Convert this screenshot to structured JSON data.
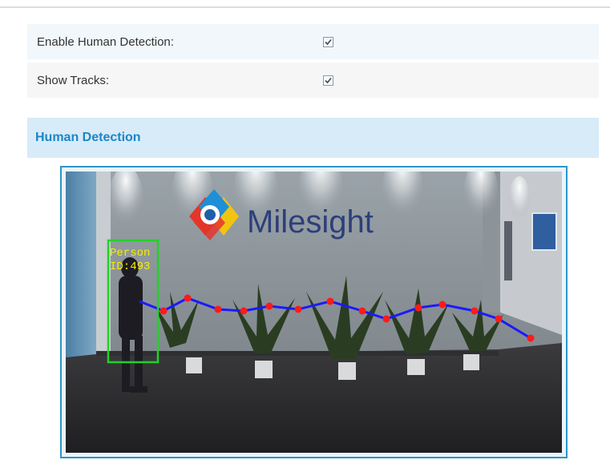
{
  "settings": {
    "enable_human_detection": {
      "label": "Enable Human Detection:",
      "checked": true
    },
    "show_tracks": {
      "label": "Show Tracks:",
      "checked": true
    }
  },
  "section": {
    "title": "Human Detection"
  },
  "video": {
    "logo_text": "Milesight",
    "detection": {
      "class_label": "Person",
      "id_label": "ID:493"
    },
    "colors": {
      "bounding_box": "#22d12a",
      "label_text": "#f5f000",
      "track_line": "#1a1aff",
      "track_point": "#ff1a1a"
    }
  }
}
